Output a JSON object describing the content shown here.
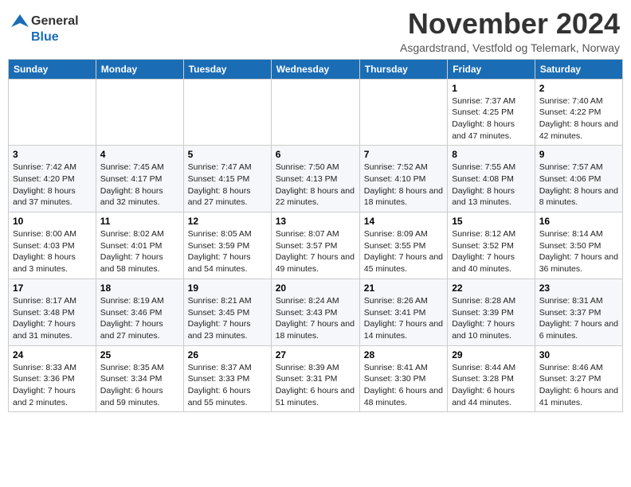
{
  "logo": {
    "line1": "General",
    "line2": "Blue"
  },
  "title": "November 2024",
  "subtitle": "Asgardstrand, Vestfold og Telemark, Norway",
  "days_of_week": [
    "Sunday",
    "Monday",
    "Tuesday",
    "Wednesday",
    "Thursday",
    "Friday",
    "Saturday"
  ],
  "weeks": [
    [
      {
        "day": "",
        "info": ""
      },
      {
        "day": "",
        "info": ""
      },
      {
        "day": "",
        "info": ""
      },
      {
        "day": "",
        "info": ""
      },
      {
        "day": "",
        "info": ""
      },
      {
        "day": "1",
        "info": "Sunrise: 7:37 AM\nSunset: 4:25 PM\nDaylight: 8 hours and 47 minutes."
      },
      {
        "day": "2",
        "info": "Sunrise: 7:40 AM\nSunset: 4:22 PM\nDaylight: 8 hours and 42 minutes."
      }
    ],
    [
      {
        "day": "3",
        "info": "Sunrise: 7:42 AM\nSunset: 4:20 PM\nDaylight: 8 hours and 37 minutes."
      },
      {
        "day": "4",
        "info": "Sunrise: 7:45 AM\nSunset: 4:17 PM\nDaylight: 8 hours and 32 minutes."
      },
      {
        "day": "5",
        "info": "Sunrise: 7:47 AM\nSunset: 4:15 PM\nDaylight: 8 hours and 27 minutes."
      },
      {
        "day": "6",
        "info": "Sunrise: 7:50 AM\nSunset: 4:13 PM\nDaylight: 8 hours and 22 minutes."
      },
      {
        "day": "7",
        "info": "Sunrise: 7:52 AM\nSunset: 4:10 PM\nDaylight: 8 hours and 18 minutes."
      },
      {
        "day": "8",
        "info": "Sunrise: 7:55 AM\nSunset: 4:08 PM\nDaylight: 8 hours and 13 minutes."
      },
      {
        "day": "9",
        "info": "Sunrise: 7:57 AM\nSunset: 4:06 PM\nDaylight: 8 hours and 8 minutes."
      }
    ],
    [
      {
        "day": "10",
        "info": "Sunrise: 8:00 AM\nSunset: 4:03 PM\nDaylight: 8 hours and 3 minutes."
      },
      {
        "day": "11",
        "info": "Sunrise: 8:02 AM\nSunset: 4:01 PM\nDaylight: 7 hours and 58 minutes."
      },
      {
        "day": "12",
        "info": "Sunrise: 8:05 AM\nSunset: 3:59 PM\nDaylight: 7 hours and 54 minutes."
      },
      {
        "day": "13",
        "info": "Sunrise: 8:07 AM\nSunset: 3:57 PM\nDaylight: 7 hours and 49 minutes."
      },
      {
        "day": "14",
        "info": "Sunrise: 8:09 AM\nSunset: 3:55 PM\nDaylight: 7 hours and 45 minutes."
      },
      {
        "day": "15",
        "info": "Sunrise: 8:12 AM\nSunset: 3:52 PM\nDaylight: 7 hours and 40 minutes."
      },
      {
        "day": "16",
        "info": "Sunrise: 8:14 AM\nSunset: 3:50 PM\nDaylight: 7 hours and 36 minutes."
      }
    ],
    [
      {
        "day": "17",
        "info": "Sunrise: 8:17 AM\nSunset: 3:48 PM\nDaylight: 7 hours and 31 minutes."
      },
      {
        "day": "18",
        "info": "Sunrise: 8:19 AM\nSunset: 3:46 PM\nDaylight: 7 hours and 27 minutes."
      },
      {
        "day": "19",
        "info": "Sunrise: 8:21 AM\nSunset: 3:45 PM\nDaylight: 7 hours and 23 minutes."
      },
      {
        "day": "20",
        "info": "Sunrise: 8:24 AM\nSunset: 3:43 PM\nDaylight: 7 hours and 18 minutes."
      },
      {
        "day": "21",
        "info": "Sunrise: 8:26 AM\nSunset: 3:41 PM\nDaylight: 7 hours and 14 minutes."
      },
      {
        "day": "22",
        "info": "Sunrise: 8:28 AM\nSunset: 3:39 PM\nDaylight: 7 hours and 10 minutes."
      },
      {
        "day": "23",
        "info": "Sunrise: 8:31 AM\nSunset: 3:37 PM\nDaylight: 7 hours and 6 minutes."
      }
    ],
    [
      {
        "day": "24",
        "info": "Sunrise: 8:33 AM\nSunset: 3:36 PM\nDaylight: 7 hours and 2 minutes."
      },
      {
        "day": "25",
        "info": "Sunrise: 8:35 AM\nSunset: 3:34 PM\nDaylight: 6 hours and 59 minutes."
      },
      {
        "day": "26",
        "info": "Sunrise: 8:37 AM\nSunset: 3:33 PM\nDaylight: 6 hours and 55 minutes."
      },
      {
        "day": "27",
        "info": "Sunrise: 8:39 AM\nSunset: 3:31 PM\nDaylight: 6 hours and 51 minutes."
      },
      {
        "day": "28",
        "info": "Sunrise: 8:41 AM\nSunset: 3:30 PM\nDaylight: 6 hours and 48 minutes."
      },
      {
        "day": "29",
        "info": "Sunrise: 8:44 AM\nSunset: 3:28 PM\nDaylight: 6 hours and 44 minutes."
      },
      {
        "day": "30",
        "info": "Sunrise: 8:46 AM\nSunset: 3:27 PM\nDaylight: 6 hours and 41 minutes."
      }
    ]
  ]
}
